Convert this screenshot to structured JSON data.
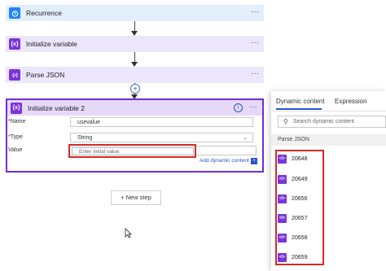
{
  "flow": {
    "steps": [
      {
        "title": "Recurrence",
        "icon": "alarm-clock-icon"
      },
      {
        "title": "Initialize variable",
        "icon": "variable-icon"
      },
      {
        "title": "Parse JSON",
        "icon": "parse-json-icon"
      }
    ],
    "expanded": {
      "title": "Initialize variable 2",
      "name_label": "Name",
      "name_value": "usevalue",
      "type_label": "Type",
      "type_value": "String",
      "value_label": "Value",
      "value_placeholder": "Enter initial value",
      "add_dynamic": "Add dynamic content"
    },
    "new_step": "+ New step",
    "more_glyph": "···",
    "variable_glyph": "{x}"
  },
  "panel": {
    "tabs": [
      "Dynamic content",
      "Expression"
    ],
    "search_placeholder": "Search dynamic content",
    "section": "Parse JSON",
    "items": [
      "20648",
      "20649",
      "20656",
      "20657",
      "20658",
      "20659"
    ]
  },
  "colors": {
    "accent": "#2b56c8",
    "trigger_bg": "#e3eefb",
    "variable_bg": "#ece6fb",
    "highlight": "#d42a2a"
  }
}
